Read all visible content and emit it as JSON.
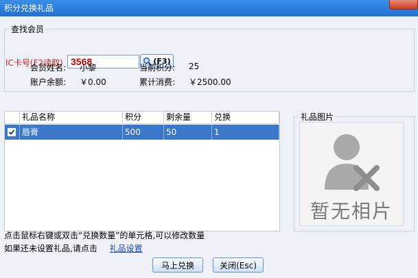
{
  "window": {
    "title": "积分兑换礼品"
  },
  "member": {
    "group_title": "查找会员",
    "ic_label": "IC卡号(F2读取)",
    "ic_value": "3568",
    "f3_label": "(F3)",
    "name_label": "会员姓名:",
    "name_value": "小黎",
    "points_label": "当前积分:",
    "points_value": "25",
    "balance_label": "账户余额:",
    "balance_value": "￥0.00",
    "spend_label": "累计消费:",
    "spend_value": "￥2500.00"
  },
  "table": {
    "columns": [
      "礼品名称",
      "积分",
      "剩余量",
      "兑换"
    ],
    "rows": [
      {
        "name": "唇膏",
        "points": "500",
        "remaining": "50",
        "redeem": "1",
        "checked": true
      }
    ]
  },
  "photo": {
    "group_title": "礼品图片",
    "no_photo_text": "暂无相片"
  },
  "hints": {
    "line1": "点击鼠标右键或双击“兑换数量”的单元格,可以修改数量",
    "line2_prefix": "如果还未设置礼品,请点击",
    "line2_link": "礼品设置"
  },
  "buttons": {
    "redeem": "马上兑换",
    "close": "关闭(Esc)"
  },
  "colors": {
    "title_bar": "#2170d2",
    "selected_row": "#3b78c9",
    "ic_label": "#c62020",
    "ic_value": "#c00000",
    "link": "#1a47b3"
  },
  "icons": {
    "f3_button": "search-icon",
    "no_photo": "user-delete-icon",
    "close": "close-icon"
  }
}
